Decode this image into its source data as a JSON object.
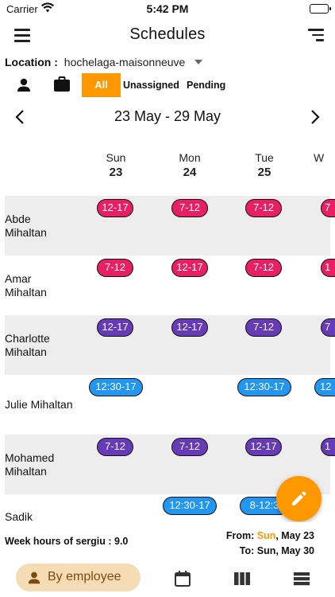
{
  "status_bar": {
    "carrier": "Carrier",
    "time": "5:42 PM"
  },
  "app_bar": {
    "title": "Schedules"
  },
  "location": {
    "label": "Location :",
    "value": "hochelaga-maisonneuve"
  },
  "filters": {
    "all": "All",
    "unassigned": "Unassigned",
    "pending": "Pending"
  },
  "week": {
    "range": "23 May - 29 May"
  },
  "days": [
    {
      "name": "Sun",
      "num": "23"
    },
    {
      "name": "Mon",
      "num": "24"
    },
    {
      "name": "Tue",
      "num": "25"
    },
    {
      "name": "W",
      "num": ""
    }
  ],
  "employees": [
    {
      "first": "Abde",
      "last": "Mihaltan",
      "shifts": [
        "12-17",
        "7-12",
        "7-12",
        "7"
      ],
      "colors": [
        "#e91e63",
        "#e91e63",
        "#e91e63",
        "#e91e63"
      ]
    },
    {
      "first": "Amar",
      "last": "Mihaltan",
      "shifts": [
        "7-12",
        "12-17",
        "7-12",
        "1"
      ],
      "colors": [
        "#e91e63",
        "#e91e63",
        "#e91e63",
        "#e91e63"
      ]
    },
    {
      "first": "Charlotte",
      "last": "Mihaltan",
      "shifts": [
        "12-17",
        "12-17",
        "7-12",
        "7"
      ],
      "colors": [
        "#673ab7",
        "#673ab7",
        "#673ab7",
        "#673ab7"
      ]
    },
    {
      "first": "Julie Mihaltan",
      "last": "",
      "shifts": [
        "12:30-17",
        "",
        "12:30-17",
        "12"
      ],
      "colors": [
        "#2196f3",
        "",
        "#2196f3",
        "#2196f3"
      ]
    },
    {
      "first": "Mohamed",
      "last": "Mihaltan",
      "shifts": [
        "7-12",
        "7-12",
        "12-17",
        "1"
      ],
      "colors": [
        "#673ab7",
        "#673ab7",
        "#673ab7",
        "#673ab7"
      ]
    },
    {
      "first": "Sadik",
      "last": "",
      "shifts": [
        "",
        "12:30-17",
        "8-12:3",
        ""
      ],
      "colors": [
        "",
        "#2196f3",
        "#2196f3",
        ""
      ]
    }
  ],
  "footer": {
    "week_hours": "Week hours of sergiu : 9.0",
    "from_label": "From:",
    "from_day": "Sun",
    "from_rest": ", May 23",
    "to": "To: Sun, May 30"
  },
  "bottom_nav": {
    "by_employee": "By employee"
  },
  "colors": {
    "accent": "#ff9800",
    "pink": "#e91e63",
    "purple": "#673ab7",
    "blue": "#2196f3"
  },
  "icons": [
    "wifi-icon",
    "battery-icon",
    "menu-icon",
    "sort-icon",
    "person-icon",
    "briefcase-icon",
    "chevron-left-icon",
    "chevron-right-icon",
    "pencil-icon",
    "calendar-icon",
    "columns-icon",
    "rows-icon"
  ]
}
